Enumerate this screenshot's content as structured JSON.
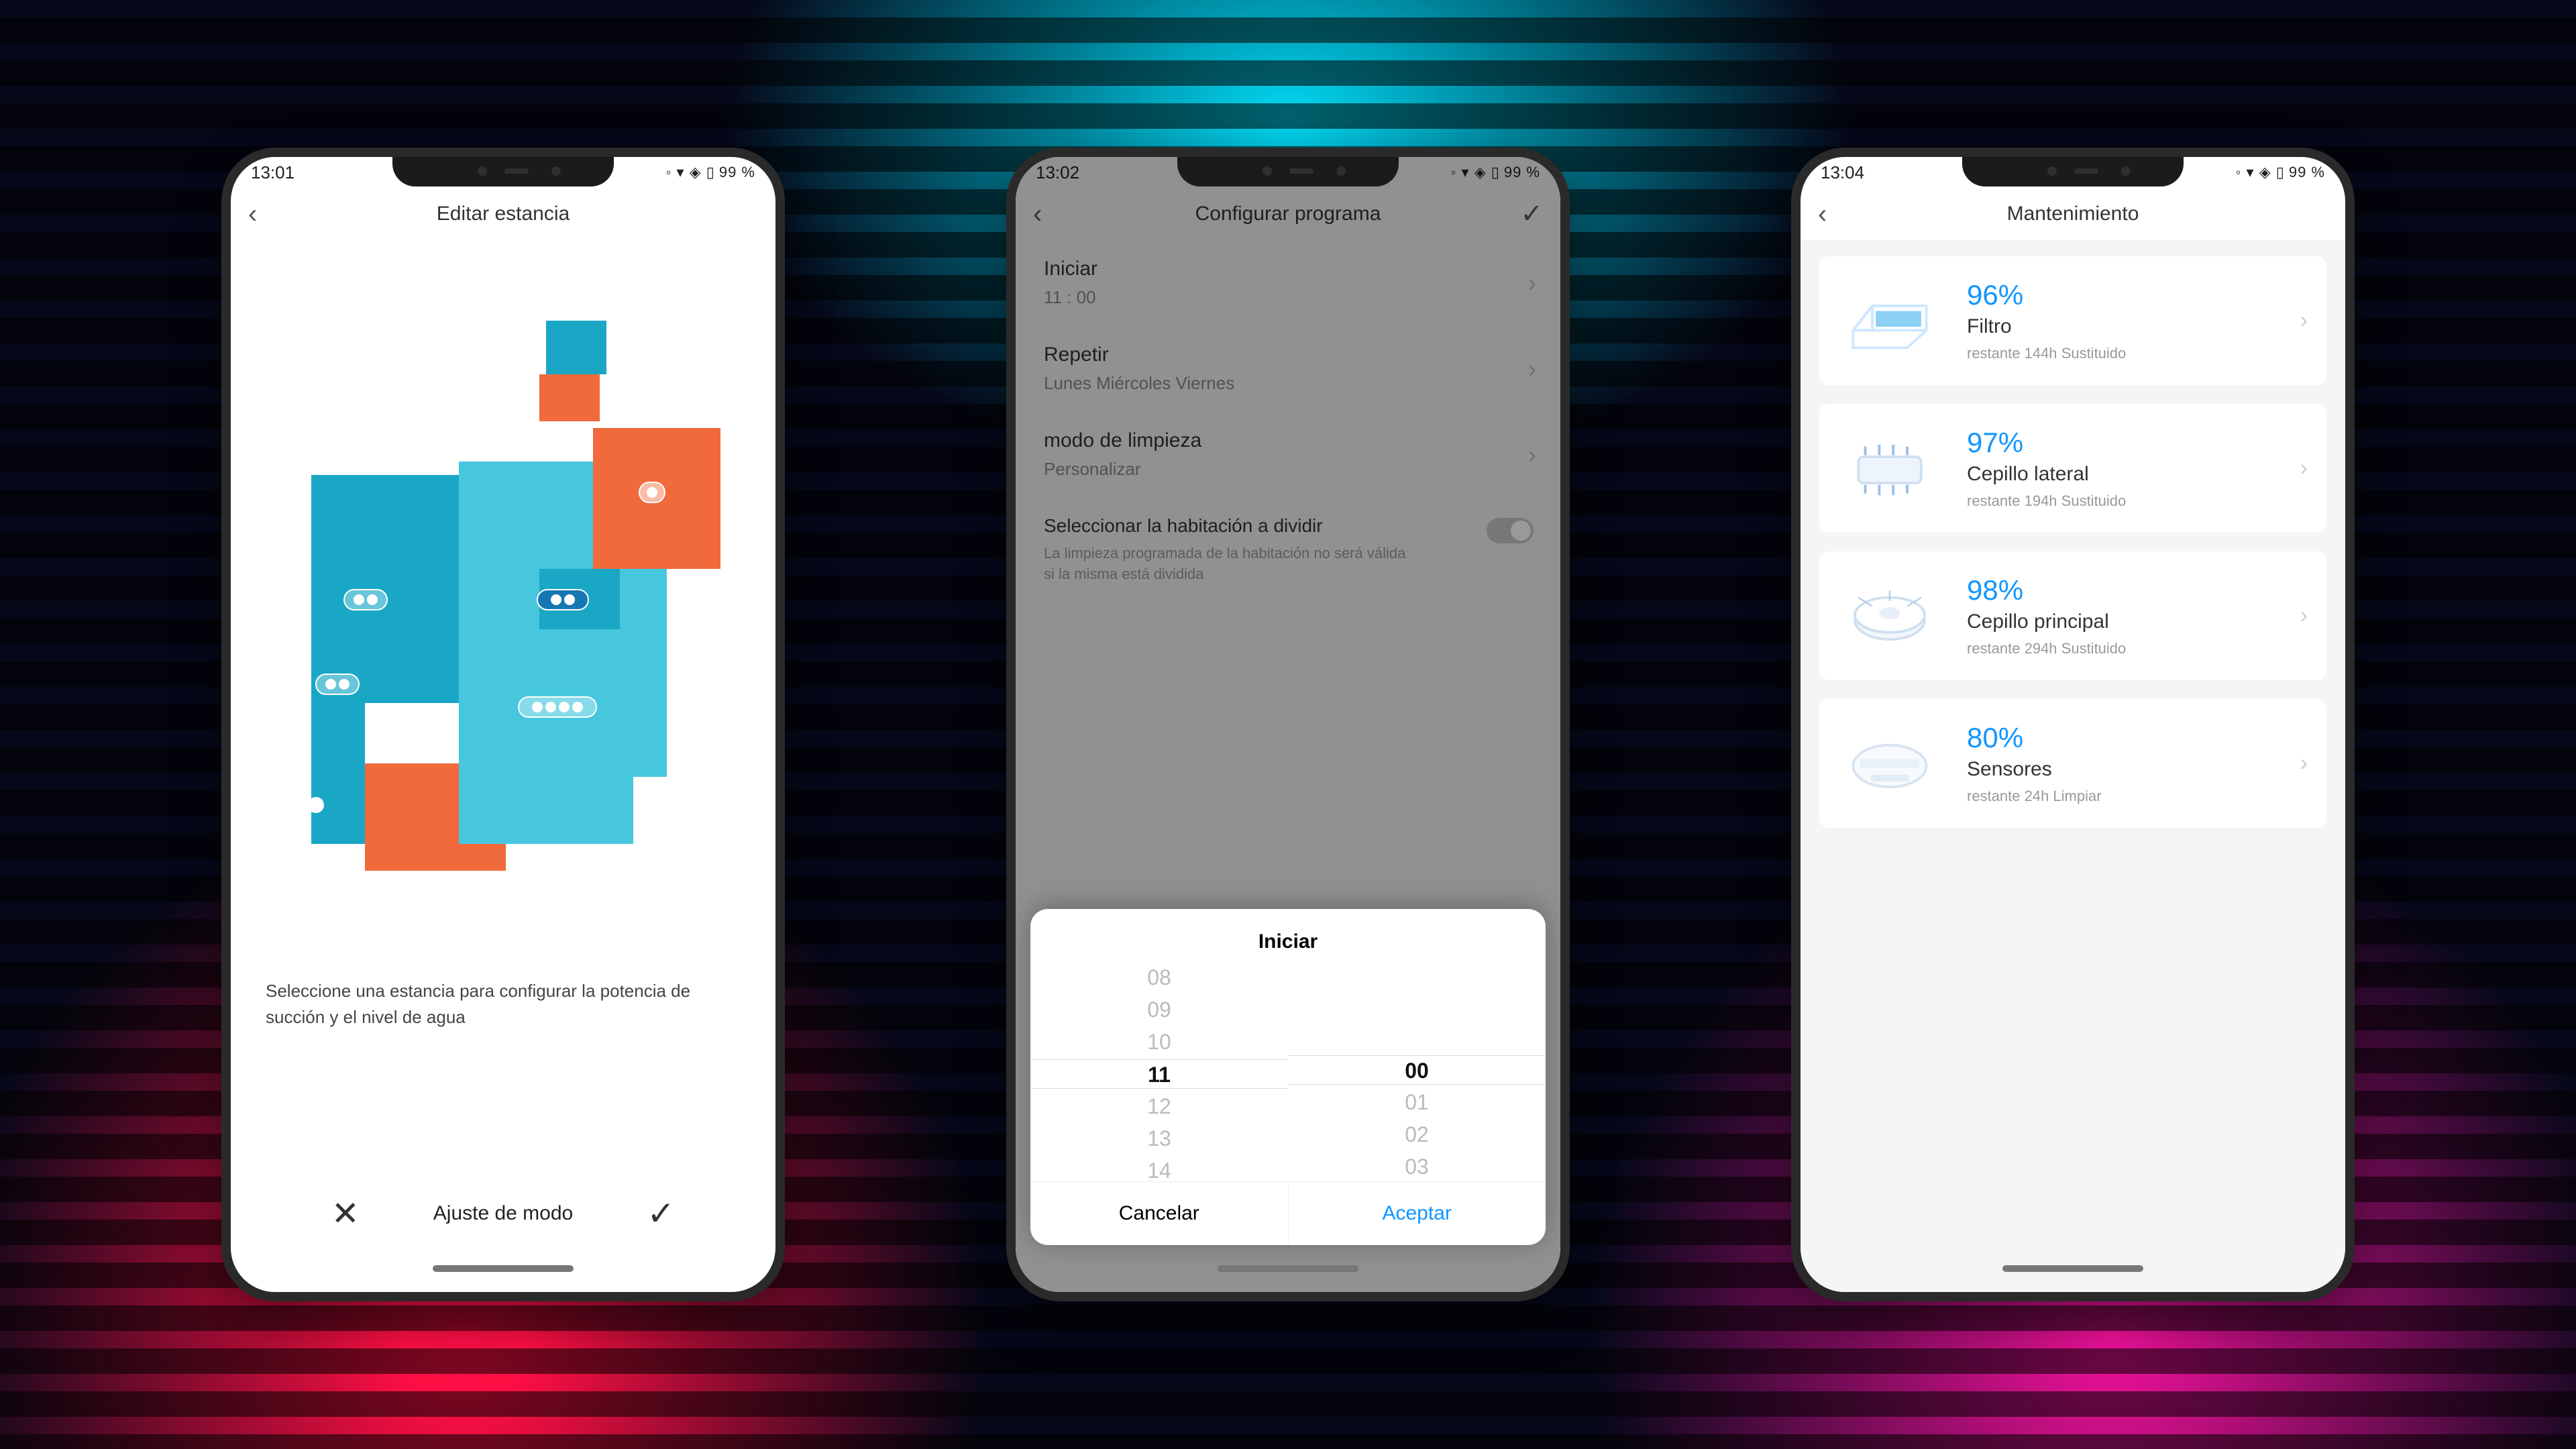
{
  "status": {
    "times": [
      "13:01",
      "13:02",
      "13:04"
    ],
    "battery": "99 %"
  },
  "phone1": {
    "title": "Editar estancia",
    "instruction": "Seleccione una estancia para configurar la potencia de succión y el nivel de agua",
    "mode_button": "Ajuste de modo"
  },
  "phone2": {
    "title": "Configurar programa",
    "start_label": "Iniciar",
    "start_value": "11 : 00",
    "repeat_label": "Repetir",
    "repeat_value": "Lunes Miércoles Viernes",
    "mode_label": "modo de limpieza",
    "mode_value": "Personalizar",
    "room_label": "Seleccionar la habitación a dividir",
    "room_desc": "La limpieza programada de la habitación no será válida si la misma está dividida",
    "sheet_title": "Iniciar",
    "hours": [
      "08",
      "09",
      "10",
      "11",
      "12",
      "13",
      "14"
    ],
    "minutes": [
      "",
      "",
      "",
      "00",
      "01",
      "02",
      "03"
    ],
    "sel_hour": 3,
    "sel_min": 3,
    "cancel": "Cancelar",
    "accept": "Aceptar"
  },
  "phone3": {
    "title": "Mantenimiento",
    "items": [
      {
        "pct": "96%",
        "name": "Filtro",
        "sub": "restante 144h Sustituido"
      },
      {
        "pct": "97%",
        "name": "Cepillo lateral",
        "sub": "restante 194h Sustituido"
      },
      {
        "pct": "98%",
        "name": "Cepillo principal",
        "sub": "restante 294h Sustituido"
      },
      {
        "pct": "80%",
        "name": "Sensores",
        "sub": "restante 24h Limpiar"
      }
    ]
  },
  "colors": {
    "accent": "#1296ff",
    "map_blue": "#1aa7c5",
    "map_cyan": "#46c7de",
    "map_orange": "#f06a3b"
  }
}
